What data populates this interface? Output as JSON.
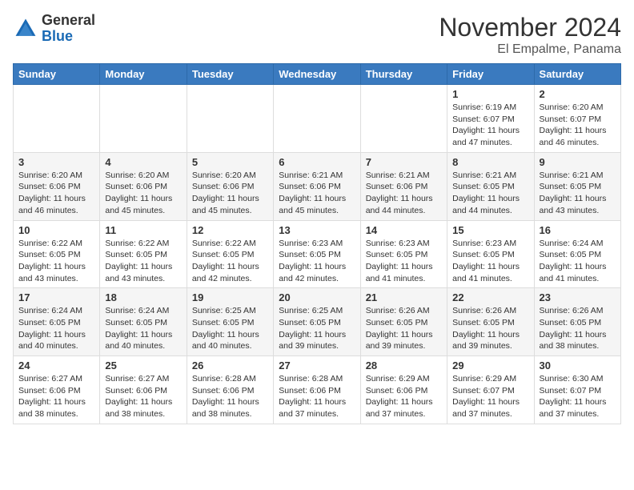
{
  "header": {
    "logo_general": "General",
    "logo_blue": "Blue",
    "month_year": "November 2024",
    "location": "El Empalme, Panama"
  },
  "days_of_week": [
    "Sunday",
    "Monday",
    "Tuesday",
    "Wednesday",
    "Thursday",
    "Friday",
    "Saturday"
  ],
  "weeks": [
    [
      {
        "day": "",
        "text": ""
      },
      {
        "day": "",
        "text": ""
      },
      {
        "day": "",
        "text": ""
      },
      {
        "day": "",
        "text": ""
      },
      {
        "day": "",
        "text": ""
      },
      {
        "day": "1",
        "text": "Sunrise: 6:19 AM\nSunset: 6:07 PM\nDaylight: 11 hours and 47 minutes."
      },
      {
        "day": "2",
        "text": "Sunrise: 6:20 AM\nSunset: 6:07 PM\nDaylight: 11 hours and 46 minutes."
      }
    ],
    [
      {
        "day": "3",
        "text": "Sunrise: 6:20 AM\nSunset: 6:06 PM\nDaylight: 11 hours and 46 minutes."
      },
      {
        "day": "4",
        "text": "Sunrise: 6:20 AM\nSunset: 6:06 PM\nDaylight: 11 hours and 45 minutes."
      },
      {
        "day": "5",
        "text": "Sunrise: 6:20 AM\nSunset: 6:06 PM\nDaylight: 11 hours and 45 minutes."
      },
      {
        "day": "6",
        "text": "Sunrise: 6:21 AM\nSunset: 6:06 PM\nDaylight: 11 hours and 45 minutes."
      },
      {
        "day": "7",
        "text": "Sunrise: 6:21 AM\nSunset: 6:06 PM\nDaylight: 11 hours and 44 minutes."
      },
      {
        "day": "8",
        "text": "Sunrise: 6:21 AM\nSunset: 6:05 PM\nDaylight: 11 hours and 44 minutes."
      },
      {
        "day": "9",
        "text": "Sunrise: 6:21 AM\nSunset: 6:05 PM\nDaylight: 11 hours and 43 minutes."
      }
    ],
    [
      {
        "day": "10",
        "text": "Sunrise: 6:22 AM\nSunset: 6:05 PM\nDaylight: 11 hours and 43 minutes."
      },
      {
        "day": "11",
        "text": "Sunrise: 6:22 AM\nSunset: 6:05 PM\nDaylight: 11 hours and 43 minutes."
      },
      {
        "day": "12",
        "text": "Sunrise: 6:22 AM\nSunset: 6:05 PM\nDaylight: 11 hours and 42 minutes."
      },
      {
        "day": "13",
        "text": "Sunrise: 6:23 AM\nSunset: 6:05 PM\nDaylight: 11 hours and 42 minutes."
      },
      {
        "day": "14",
        "text": "Sunrise: 6:23 AM\nSunset: 6:05 PM\nDaylight: 11 hours and 41 minutes."
      },
      {
        "day": "15",
        "text": "Sunrise: 6:23 AM\nSunset: 6:05 PM\nDaylight: 11 hours and 41 minutes."
      },
      {
        "day": "16",
        "text": "Sunrise: 6:24 AM\nSunset: 6:05 PM\nDaylight: 11 hours and 41 minutes."
      }
    ],
    [
      {
        "day": "17",
        "text": "Sunrise: 6:24 AM\nSunset: 6:05 PM\nDaylight: 11 hours and 40 minutes."
      },
      {
        "day": "18",
        "text": "Sunrise: 6:24 AM\nSunset: 6:05 PM\nDaylight: 11 hours and 40 minutes."
      },
      {
        "day": "19",
        "text": "Sunrise: 6:25 AM\nSunset: 6:05 PM\nDaylight: 11 hours and 40 minutes."
      },
      {
        "day": "20",
        "text": "Sunrise: 6:25 AM\nSunset: 6:05 PM\nDaylight: 11 hours and 39 minutes."
      },
      {
        "day": "21",
        "text": "Sunrise: 6:26 AM\nSunset: 6:05 PM\nDaylight: 11 hours and 39 minutes."
      },
      {
        "day": "22",
        "text": "Sunrise: 6:26 AM\nSunset: 6:05 PM\nDaylight: 11 hours and 39 minutes."
      },
      {
        "day": "23",
        "text": "Sunrise: 6:26 AM\nSunset: 6:05 PM\nDaylight: 11 hours and 38 minutes."
      }
    ],
    [
      {
        "day": "24",
        "text": "Sunrise: 6:27 AM\nSunset: 6:06 PM\nDaylight: 11 hours and 38 minutes."
      },
      {
        "day": "25",
        "text": "Sunrise: 6:27 AM\nSunset: 6:06 PM\nDaylight: 11 hours and 38 minutes."
      },
      {
        "day": "26",
        "text": "Sunrise: 6:28 AM\nSunset: 6:06 PM\nDaylight: 11 hours and 38 minutes."
      },
      {
        "day": "27",
        "text": "Sunrise: 6:28 AM\nSunset: 6:06 PM\nDaylight: 11 hours and 37 minutes."
      },
      {
        "day": "28",
        "text": "Sunrise: 6:29 AM\nSunset: 6:06 PM\nDaylight: 11 hours and 37 minutes."
      },
      {
        "day": "29",
        "text": "Sunrise: 6:29 AM\nSunset: 6:07 PM\nDaylight: 11 hours and 37 minutes."
      },
      {
        "day": "30",
        "text": "Sunrise: 6:30 AM\nSunset: 6:07 PM\nDaylight: 11 hours and 37 minutes."
      }
    ]
  ]
}
